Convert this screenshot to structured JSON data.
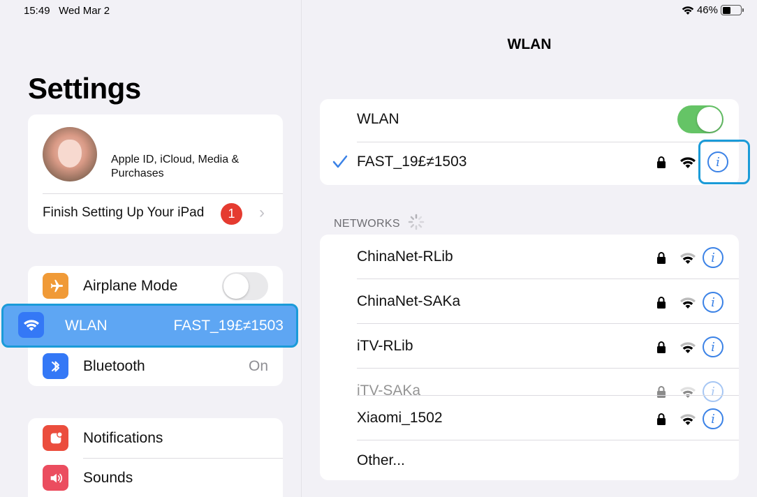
{
  "status_bar": {
    "time": "15:49",
    "date": "Wed Mar 2",
    "battery_percent": "46%",
    "battery_level": 0.46
  },
  "sidebar": {
    "title": "Settings",
    "profile": {
      "subtitle": "Apple ID, iCloud, Media & Purchases"
    },
    "finish_setup": {
      "label": "Finish Setting Up Your iPad",
      "badge": "1"
    },
    "connectivity": [
      {
        "id": "airplane",
        "label": "Airplane Mode",
        "toggle_on": false,
        "icon": "airplane-icon",
        "color": "#f09a37"
      },
      {
        "id": "wlan",
        "label": "WLAN",
        "value": "FAST_19£≠1503",
        "selected": true,
        "icon": "wifi-icon",
        "color": "#3478f6"
      },
      {
        "id": "bluetooth",
        "label": "Bluetooth",
        "value": "On",
        "icon": "bluetooth-icon",
        "color": "#3478f6"
      }
    ],
    "notifications_group": [
      {
        "id": "notifications",
        "label": "Notifications",
        "icon": "bell-icon",
        "color": "#eb4d3d"
      },
      {
        "id": "sounds",
        "label": "Sounds",
        "icon": "speaker-icon",
        "color": "#eb4d5f"
      }
    ]
  },
  "detail": {
    "title": "WLAN",
    "wlan_toggle": {
      "label": "WLAN",
      "on": true,
      "color": "#65c466"
    },
    "connected_network": {
      "name": "FAST_19£≠1503",
      "secured": true
    },
    "networks_header": "NETWORKS",
    "networks": [
      {
        "name": "ChinaNet-RLib",
        "secured": true
      },
      {
        "name": "ChinaNet-SAKa",
        "secured": true
      },
      {
        "name": "iTV-RLib",
        "secured": true
      },
      {
        "name": "iTV-SAKa",
        "secured": true
      },
      {
        "name": "Xiaomi_1502",
        "secured": true
      }
    ],
    "other_label": "Other..."
  },
  "colors": {
    "accent": "#3b82e6",
    "highlight_border": "#1b9bd8",
    "selected_row": "#5ea6f3"
  }
}
